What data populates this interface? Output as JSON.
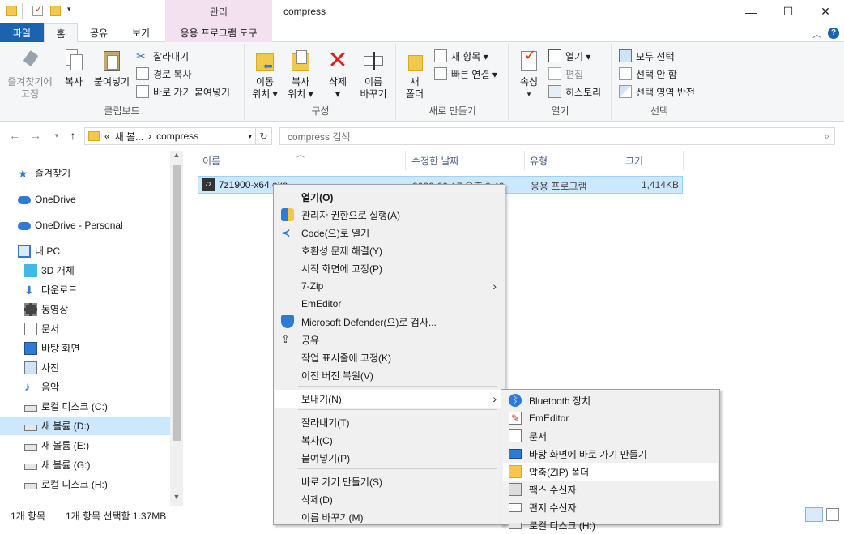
{
  "window": {
    "title": "compress",
    "contextual_tab_header": "관리",
    "controls": {
      "minimize": "—",
      "maximize": "☐",
      "close": "✕"
    }
  },
  "tabs": [
    "파일",
    "홈",
    "공유",
    "보기",
    "응용 프로그램 도구"
  ],
  "ribbon": {
    "clipboard": {
      "label": "클립보드",
      "pin": "즐겨찾기에\n고정",
      "copy": "복사",
      "paste": "붙여넣기",
      "cut": "잘라내기",
      "copy_path": "경로 복사",
      "paste_shortcut": "바로 가기 붙여넣기"
    },
    "organize": {
      "label": "구성",
      "move_l1": "이동",
      "move_l2": "위치 ▾",
      "copyto_l1": "복사",
      "copyto_l2": "위치 ▾",
      "delete_l1": "삭제",
      "delete_l2": "▾",
      "rename_l1": "이름",
      "rename_l2": "바꾸기"
    },
    "new": {
      "label": "새로 만들기",
      "folder_l1": "새",
      "folder_l2": "폴더",
      "new_item": "새 항목 ▾",
      "easy_access": "빠른 연결 ▾"
    },
    "open": {
      "label": "열기",
      "properties": "속성",
      "open": "열기 ▾",
      "edit": "편집",
      "history": "히스토리"
    },
    "select": {
      "label": "선택",
      "select_all": "모두 선택",
      "select_none": "선택 안 함",
      "invert": "선택 영역 반전"
    }
  },
  "address": {
    "path_prefix": "«",
    "crumb1": "새 볼...",
    "sep": "›",
    "crumb2": "compress",
    "search_placeholder": "compress 검색"
  },
  "nav_items": [
    {
      "label": "즐겨찾기",
      "icon": "star-icon"
    },
    {
      "label": "OneDrive",
      "icon": "cloud-icon"
    },
    {
      "label": "OneDrive - Personal",
      "icon": "cloud-icon"
    },
    {
      "label": "내 PC",
      "icon": "pc-icon"
    },
    {
      "label": "3D 개체",
      "icon": "cube-icon"
    },
    {
      "label": "다운로드",
      "icon": "download-icon"
    },
    {
      "label": "동영상",
      "icon": "video-icon"
    },
    {
      "label": "문서",
      "icon": "document-icon"
    },
    {
      "label": "바탕 화면",
      "icon": "desktop-icon"
    },
    {
      "label": "사진",
      "icon": "picture-icon"
    },
    {
      "label": "음악",
      "icon": "music-icon"
    },
    {
      "label": "로컬 디스크 (C:)",
      "icon": "drive-icon"
    },
    {
      "label": "새 볼륨 (D:)",
      "icon": "drive-icon"
    },
    {
      "label": "새 볼륨 (E:)",
      "icon": "drive-icon"
    },
    {
      "label": "새 볼륨 (G:)",
      "icon": "drive-icon"
    },
    {
      "label": "로컬 디스크 (H:)",
      "icon": "drive-icon"
    }
  ],
  "columns": [
    "이름",
    "수정한 날짜",
    "유형",
    "크기"
  ],
  "file": {
    "name": "7z1900-x64.exe",
    "date": "2020-09-17 오후 8:49",
    "type": "응용 프로그램",
    "size": "1,414KB"
  },
  "context_menu": [
    "열기(O)",
    "관리자 권한으로 실행(A)",
    "Code(으)로 열기",
    "호환성 문제 해결(Y)",
    "시작 화면에 고정(P)",
    "7-Zip",
    "EmEditor",
    "Microsoft Defender(으)로 검사...",
    "공유",
    "작업 표시줄에 고정(K)",
    "이전 버전 복원(V)",
    "보내기(N)",
    "잘라내기(T)",
    "복사(C)",
    "붙여넣기(P)",
    "바로 가기 만들기(S)",
    "삭제(D)",
    "이름 바꾸기(M)"
  ],
  "send_to_menu": [
    "Bluetooth 장치",
    "EmEditor",
    "문서",
    "바탕 화면에 바로 가기 만들기",
    "압축(ZIP) 폴더",
    "팩스 수신자",
    "편지 수신자",
    "로컬 디스크 (H:)"
  ],
  "status": {
    "count": "1개 항목",
    "selected": "1개 항목 선택함 1.37MB"
  },
  "colors": {
    "accent": "#1a63b0",
    "selection": "#cce8ff",
    "contextual": "#f4e1f0",
    "menu_bg": "#f0f0f0"
  }
}
